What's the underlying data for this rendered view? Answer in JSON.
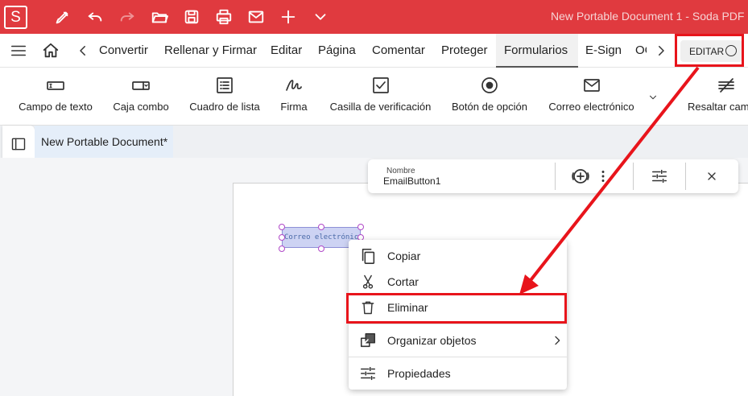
{
  "app": {
    "logo_letter": "S",
    "title": "New Portable Document 1  -  Soda PDF"
  },
  "menubar": {
    "items": [
      "Convertir",
      "Rellenar y Firmar",
      "Editar",
      "Página",
      "Comentar",
      "Proteger",
      "Formularios",
      "E-Sign",
      "OCR"
    ],
    "active": "Formularios",
    "edit_toggle_label": "EDITAR"
  },
  "ribbon": {
    "items": [
      {
        "label": "Campo de texto",
        "icon": "text-field-icon"
      },
      {
        "label": "Caja combo",
        "icon": "combo-box-icon"
      },
      {
        "label": "Cuadro de lista",
        "icon": "list-box-icon"
      },
      {
        "label": "Firma",
        "icon": "signature-icon"
      },
      {
        "label": "Casilla de verificación",
        "icon": "checkbox-icon"
      },
      {
        "label": "Botón de opción",
        "icon": "radio-button-icon"
      },
      {
        "label": "Correo electrónico",
        "icon": "email-icon"
      },
      {
        "label": "Resaltar campos",
        "icon": "highlight-fields-icon"
      }
    ]
  },
  "document": {
    "tab_title": "New Portable Document*"
  },
  "field_toolbar": {
    "name_caption": "Nombre",
    "name_value": "EmailButton1"
  },
  "email_field": {
    "text": "Correo electrónico"
  },
  "context_menu": {
    "items": [
      {
        "label": "Copiar",
        "icon": "copy-icon"
      },
      {
        "label": "Cortar",
        "icon": "scissors-icon"
      },
      {
        "label": "Eliminar",
        "icon": "trash-icon"
      },
      {
        "label": "Organizar objetos",
        "icon": "arrange-icon"
      },
      {
        "label": "Propiedades",
        "icon": "properties-icon"
      }
    ]
  },
  "colors": {
    "title_bar": "#e03a3f",
    "highlight": "#e8141b",
    "field_fill": "#cdd3f3"
  }
}
